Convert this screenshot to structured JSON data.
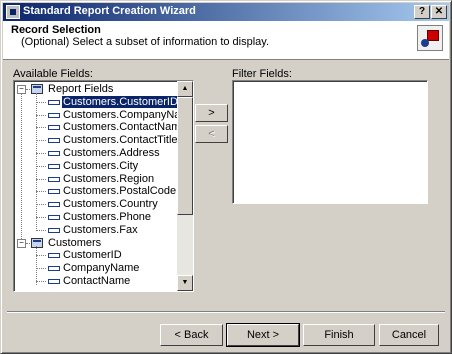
{
  "window": {
    "title": "Standard Report Creation Wizard"
  },
  "titlebar_buttons": {
    "help": "?",
    "close": "✕"
  },
  "header": {
    "title": "Record Selection",
    "subtitle": "(Optional)  Select a subset of information to display."
  },
  "available_fields": {
    "label": "Available Fields:",
    "tree": {
      "root_label": "Report Fields",
      "root_items": [
        "Customers.CustomerID",
        "Customers.CompanyName",
        "Customers.ContactName",
        "Customers.ContactTitle",
        "Customers.Address",
        "Customers.City",
        "Customers.Region",
        "Customers.PostalCode",
        "Customers.Country",
        "Customers.Phone",
        "Customers.Fax"
      ],
      "selected_item": "Customers.CustomerID",
      "table_label": "Customers",
      "table_items": [
        "CustomerID",
        "CompanyName",
        "ContactName"
      ]
    }
  },
  "move_buttons": {
    "add": ">",
    "remove": "<"
  },
  "filter_fields": {
    "label": "Filter Fields:"
  },
  "footer": {
    "back": "< Back",
    "next": "Next >",
    "finish": "Finish",
    "cancel": "Cancel"
  },
  "scroll_arrows": {
    "up": "▲",
    "down": "▼"
  },
  "icons": {
    "app": "crystal-reports-icon",
    "wizard": "wizard-icon",
    "folder": "report-fields-icon",
    "table": "table-icon",
    "field": "field-icon"
  }
}
